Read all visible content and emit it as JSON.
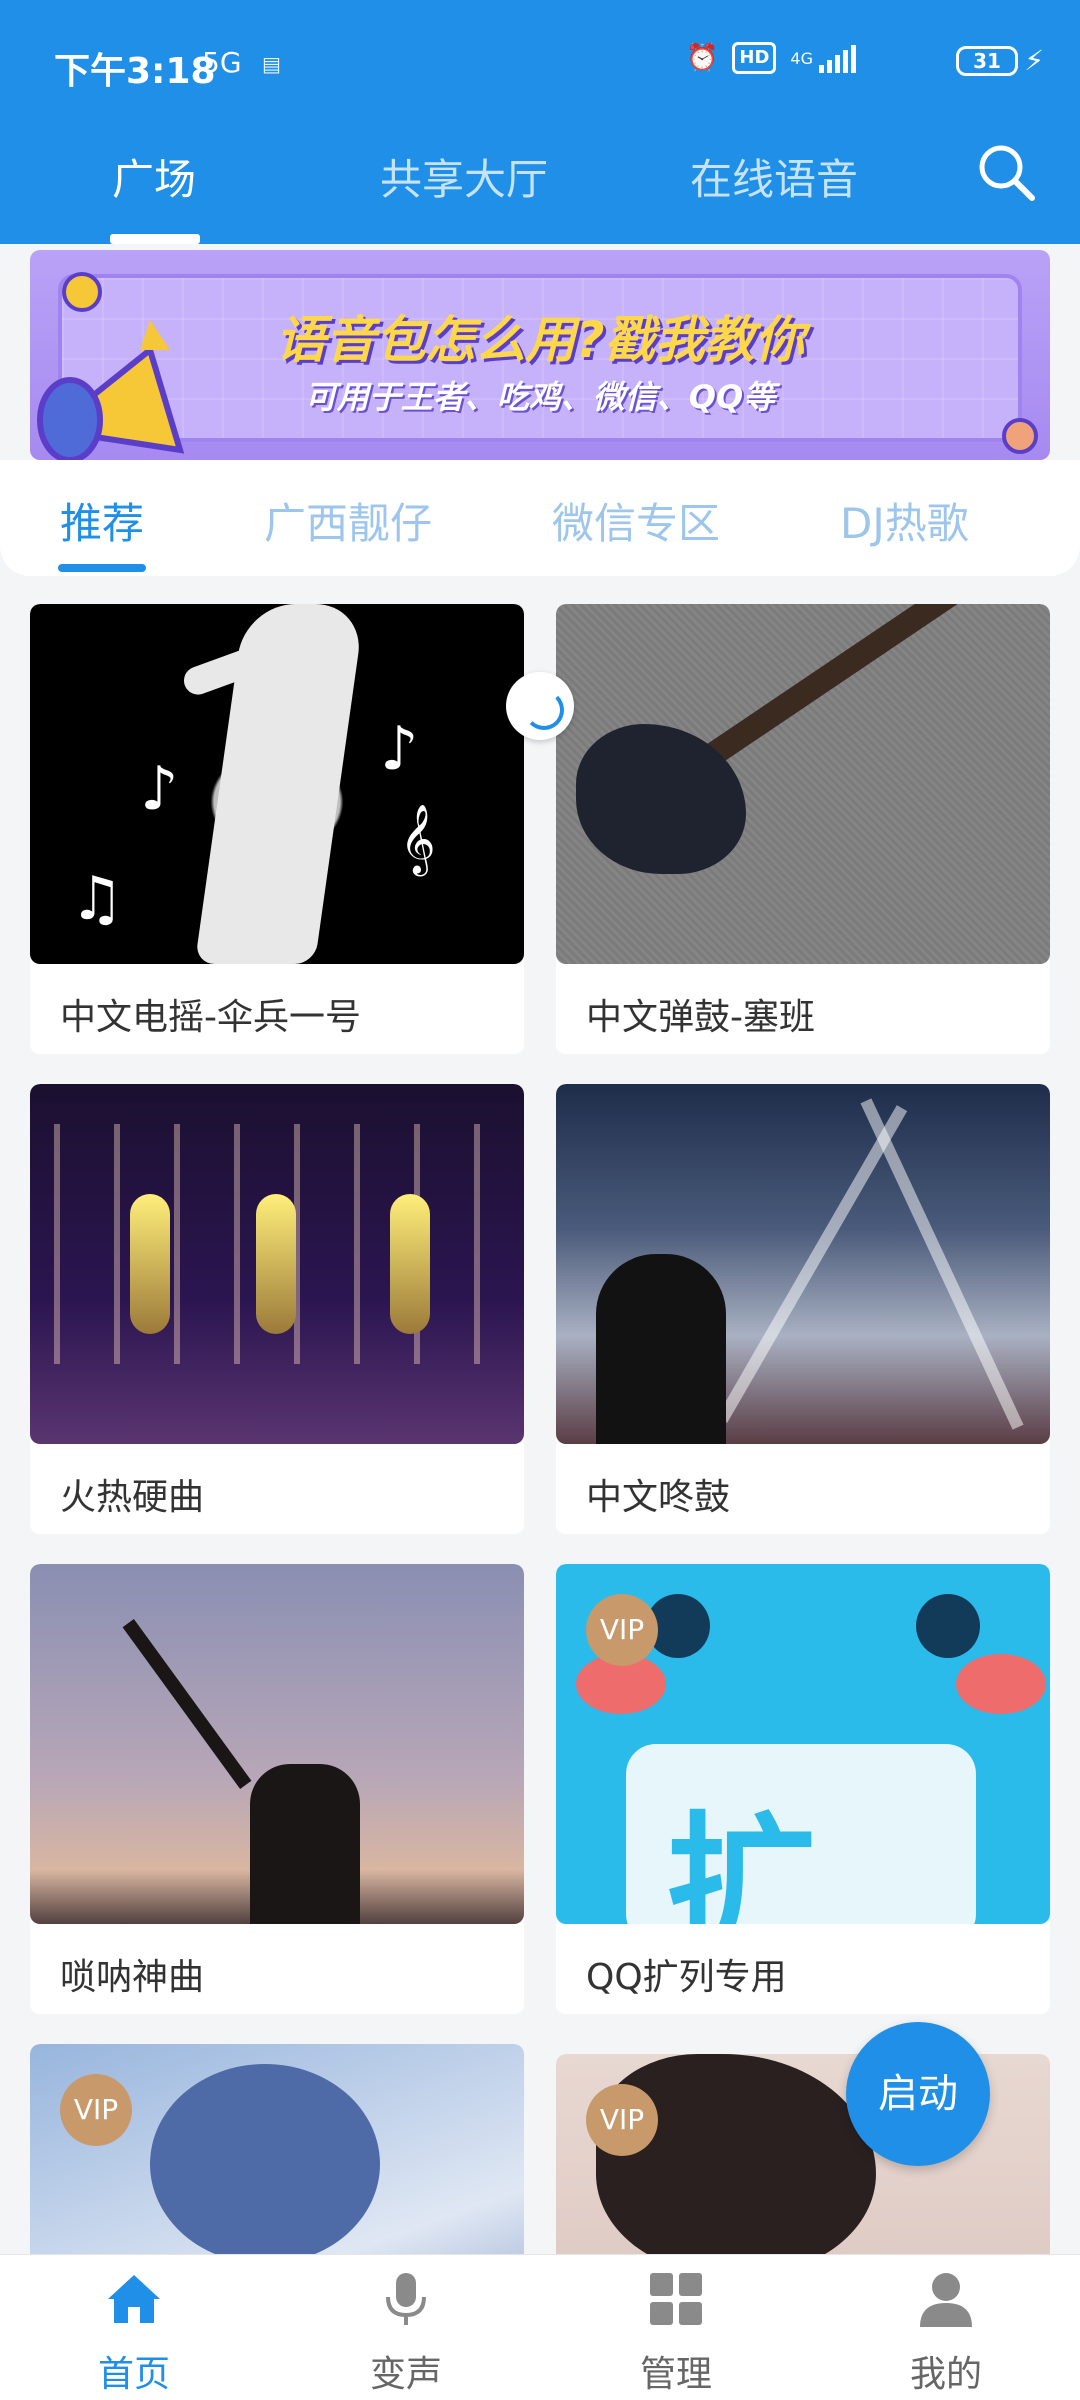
{
  "status_bar": {
    "time": "下午3:18",
    "network": "5G",
    "hd": "HD",
    "net2": "4G",
    "battery": "31"
  },
  "top_tabs": [
    {
      "label": "广场",
      "active": true
    },
    {
      "label": "共享大厅",
      "active": false
    },
    {
      "label": "在线语音",
      "active": false
    }
  ],
  "banner": {
    "title": "语音包怎么用?戳我教你",
    "subtitle": "可用于王者、吃鸡、微信、QQ等"
  },
  "sub_tabs": [
    {
      "label": "推荐",
      "active": true
    },
    {
      "label": "广西靓仔",
      "active": false
    },
    {
      "label": "微信专区",
      "active": false
    },
    {
      "label": "DJ热歌",
      "active": false
    }
  ],
  "cards": [
    {
      "title": "中文电摇-伞兵一号",
      "vip": false,
      "image": "dancer-silhouette"
    },
    {
      "title": "中文弹鼓-塞班",
      "vip": false,
      "image": "electric-guitar"
    },
    {
      "title": "火热硬曲",
      "vip": false,
      "image": "stage-robots"
    },
    {
      "title": "中文咚鼓",
      "vip": false,
      "image": "concert-crowd"
    },
    {
      "title": "唢呐神曲",
      "vip": false,
      "image": "sunset-suona"
    },
    {
      "title": "QQ扩列专用",
      "vip": true,
      "vip_label": "VIP",
      "image": "qq-cartoon"
    },
    {
      "title": "",
      "vip": true,
      "vip_label": "VIP",
      "image": "anime-violinist"
    },
    {
      "title": "",
      "vip": true,
      "vip_label": "VIP",
      "image": "girl-portrait"
    }
  ],
  "fab": {
    "label": "启动"
  },
  "bottom_nav": [
    {
      "label": "首页",
      "icon": "home-icon",
      "active": true
    },
    {
      "label": "变声",
      "icon": "microphone-icon",
      "active": false
    },
    {
      "label": "管理",
      "icon": "grid-icon",
      "active": false
    },
    {
      "label": "我的",
      "icon": "person-icon",
      "active": false
    }
  ],
  "colors": {
    "primary": "#1f8fe8",
    "inactive_subtab": "#9ec6ec",
    "vip_badge": "#c8996a"
  }
}
